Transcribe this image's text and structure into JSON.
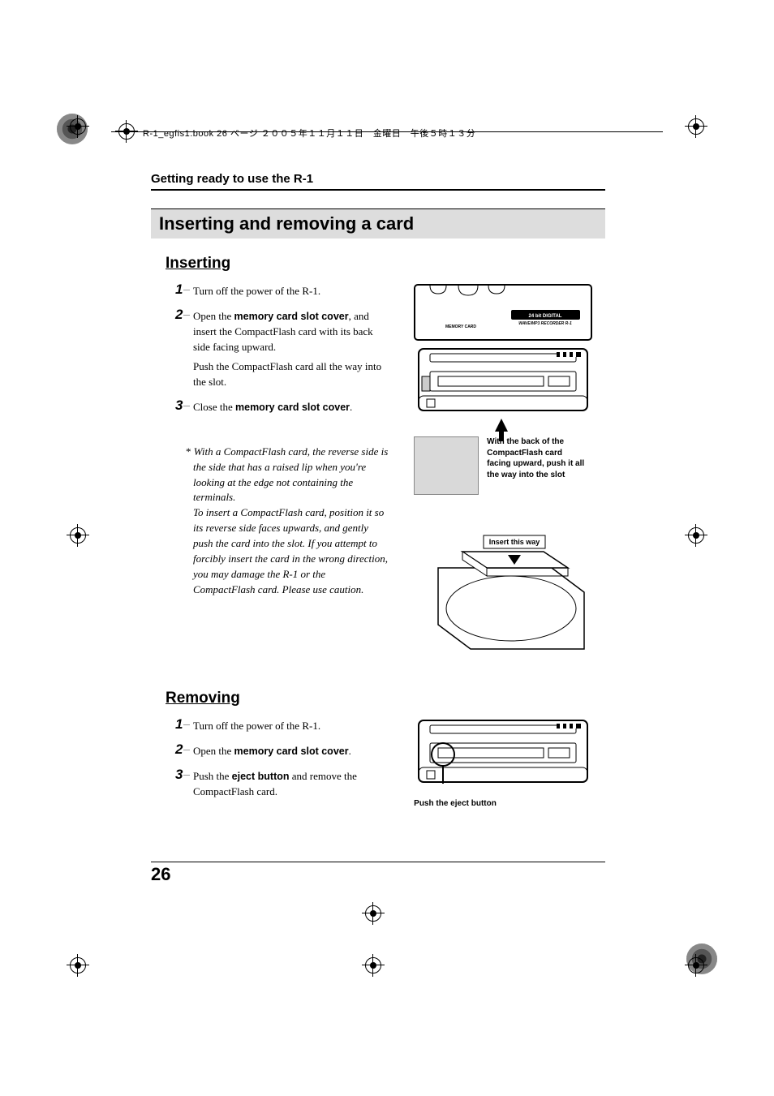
{
  "header": {
    "running_line": "R-1_egfis1.book  26 ページ  ２００５年１１月１１日　金曜日　午後５時１３分"
  },
  "section_title": "Getting ready to use the R-1",
  "main_title": "Inserting and removing a card",
  "inserting": {
    "heading": "Inserting",
    "steps": [
      {
        "num": "1",
        "text": "Turn off the power of the R-1."
      },
      {
        "num": "2",
        "text_a": "Open the ",
        "bold_a": "memory card slot cover",
        "text_b": ", and insert the CompactFlash card with its back side facing upward.",
        "text_c": "Push the CompactFlash card all the way into the slot."
      },
      {
        "num": "3",
        "text_a": "Close the ",
        "bold_a": "memory card slot cover",
        "text_b": "."
      }
    ],
    "note_star": "*",
    "note_a": "With a CompactFlash card, the reverse side is the side that has a raised lip when you're looking at the edge not containing the terminals.",
    "note_b": "To insert a CompactFlash card, position it so its reverse side faces upwards, and gently push the card into the slot. If you attempt to forcibly insert the card in the wrong direction, you may damage the R-1 or the CompactFlash card. Please use caution.",
    "fig_labels": {
      "badge": "24 bit DIGITAL",
      "recorder": "WAVE/MP3 RECORDER R-1",
      "memory_card": "MEMORY CARD",
      "caption": "With the back of the CompactFlash card facing upward, push it all the way into the slot",
      "insert_this_way": "Insert this way"
    }
  },
  "removing": {
    "heading": "Removing",
    "steps": [
      {
        "num": "1",
        "text": "Turn off the power of the R-1."
      },
      {
        "num": "2",
        "text_a": "Open the ",
        "bold_a": "memory card slot cover",
        "text_b": "."
      },
      {
        "num": "3",
        "text_a": "Push the ",
        "bold_a": "eject button",
        "text_b": " and remove the CompactFlash card."
      }
    ],
    "fig_caption": "Push the eject button"
  },
  "page_number": "26"
}
